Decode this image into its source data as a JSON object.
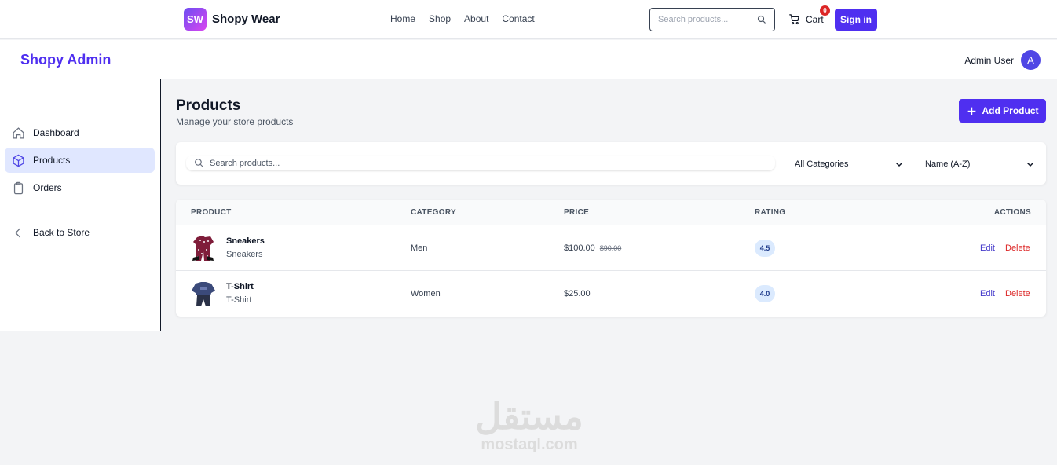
{
  "store": {
    "logo_mark": "SW",
    "name": "Shopy Wear",
    "nav": [
      "Home",
      "Shop",
      "About",
      "Contact"
    ],
    "search_placeholder": "Search products...",
    "cart_label": "Cart",
    "cart_count": "0",
    "signin_label": "Sign in"
  },
  "admin": {
    "title": "Shopy Admin",
    "user_name": "Admin User",
    "avatar_initial": "A"
  },
  "sidebar": {
    "items": [
      {
        "label": "Dashboard",
        "icon": "home-icon"
      },
      {
        "label": "Products",
        "icon": "cube-icon",
        "active": true
      },
      {
        "label": "Orders",
        "icon": "clipboard-icon"
      },
      {
        "label": "Back to Store",
        "icon": "chevron-left-icon"
      }
    ]
  },
  "main": {
    "title": "Products",
    "subtitle": "Manage your store products",
    "add_label": "Add Product",
    "filters": {
      "search_placeholder": "Search products...",
      "category": "All Categories",
      "sort": "Name (A-Z)"
    },
    "table": {
      "headers": [
        "PRODUCT",
        "CATEGORY",
        "PRICE",
        "RATING",
        "ACTIONS"
      ],
      "rows": [
        {
          "name": "Sneakers",
          "subtitle": "Sneakers",
          "category": "Men",
          "price": "$100.00",
          "old_price": "$90.00",
          "rating": "4.5",
          "edit": "Edit",
          "delete": "Delete"
        },
        {
          "name": "T-Shirt",
          "subtitle": "T-Shirt",
          "category": "Women",
          "price": "$25.00",
          "old_price": "",
          "rating": "4.0",
          "edit": "Edit",
          "delete": "Delete"
        }
      ]
    }
  },
  "watermark": {
    "arabic": "مستقل",
    "latin": "mostaql.com"
  },
  "colors": {
    "accent": "#4f2ff0",
    "danger": "#dc2626",
    "active_bg": "#e0e7ff",
    "rating_bg": "#dbeafe"
  }
}
